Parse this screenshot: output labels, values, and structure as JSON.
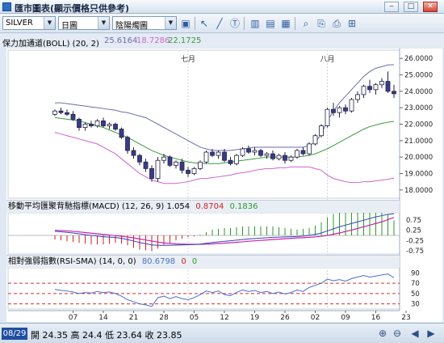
{
  "window": {
    "title": "匯市圖表(顯示價格只供參考)",
    "buttons": [
      "‒",
      "□",
      "✕"
    ]
  },
  "toolbar": {
    "symbol": "SILVER",
    "period": "日圖",
    "chart_style": "陰陽燭圖",
    "icons": [
      "save-icon",
      "cursor-icon",
      "line-tool-icon",
      "text-tool-icon",
      "bar-chart-icon",
      "indicator-icon",
      "compare-icon",
      "search-icon",
      "export-icon",
      "layout-icon"
    ]
  },
  "boll": {
    "label": "保力加通道(BOLL) (20, 2)",
    "v1": "25.6164",
    "v2": "18.7286",
    "v3": "22.1725",
    "c1": "#6b6bb0",
    "c2": "#cc66cc",
    "c3": "#3a9a3a"
  },
  "macd": {
    "label": "移動平均匯聚背馳指標(MACD) (12, 26, 9)",
    "v1": "1.054",
    "v2": "0.8704",
    "v3": "0.1836",
    "c2": "#cc2222",
    "c3": "#2a9a2a"
  },
  "rsi": {
    "label": "相對強弱指數(RSI-SMA) (14, 0, 0)",
    "v1": "80.6798",
    "v2": "0",
    "v3": "0",
    "c1": "#4a6fcc",
    "c2": "#cc2222",
    "c3": "#2a9a2a"
  },
  "chart_data": {
    "type": "candlestick",
    "month_labels": [
      {
        "label": "七月",
        "index": 22
      },
      {
        "label": "八月",
        "index": 45
      }
    ],
    "x_tick_labels": [
      {
        "label": "07",
        "index": 3
      },
      {
        "label": "14",
        "index": 8
      },
      {
        "label": "21",
        "index": 13
      },
      {
        "label": "28",
        "index": 18
      },
      {
        "label": "05",
        "index": 23
      },
      {
        "label": "12",
        "index": 28
      },
      {
        "label": "19",
        "index": 33
      },
      {
        "label": "26",
        "index": 38
      },
      {
        "label": "02",
        "index": 43
      },
      {
        "label": "09",
        "index": 48
      },
      {
        "label": "16",
        "index": 53
      },
      {
        "label": "23",
        "index": 58
      }
    ],
    "price_axis": {
      "ylim": [
        17.5,
        26.5
      ],
      "ticks": [
        "26.0000",
        "25.0000",
        "24.0000",
        "23.0000",
        "22.0000",
        "21.0000",
        "20.0000",
        "19.0000",
        "18.0000"
      ]
    },
    "macd_axis": {
      "ylim": [
        -0.9,
        1.1
      ],
      "ticks": [
        "0.75",
        "0.25",
        "-0.25",
        "-0.75"
      ]
    },
    "rsi_axis": {
      "ylim": [
        20,
        100
      ],
      "ticks": [
        "90",
        "70",
        "50",
        "30"
      ],
      "bands": [
        70,
        50,
        30
      ]
    },
    "candles": [
      [
        22.6,
        22.9,
        22.5,
        22.8
      ],
      [
        22.8,
        23.0,
        22.6,
        22.7
      ],
      [
        22.7,
        22.9,
        22.5,
        22.6
      ],
      [
        22.6,
        22.8,
        22.2,
        22.3
      ],
      [
        22.3,
        22.4,
        21.6,
        21.8
      ],
      [
        21.8,
        22.1,
        21.6,
        22.0
      ],
      [
        22.0,
        22.2,
        21.8,
        21.9
      ],
      [
        21.9,
        22.3,
        21.8,
        22.2
      ],
      [
        22.2,
        22.4,
        21.8,
        21.9
      ],
      [
        21.9,
        22.1,
        21.7,
        22.0
      ],
      [
        22.0,
        22.1,
        21.6,
        21.7
      ],
      [
        21.7,
        21.8,
        21.1,
        21.2
      ],
      [
        21.2,
        21.3,
        20.2,
        20.4
      ],
      [
        20.4,
        20.6,
        19.9,
        20.1
      ],
      [
        20.1,
        20.2,
        19.5,
        19.7
      ],
      [
        19.7,
        19.9,
        19.1,
        19.3
      ],
      [
        19.3,
        19.5,
        18.5,
        18.7
      ],
      [
        18.7,
        20.0,
        18.5,
        19.8
      ],
      [
        19.8,
        20.2,
        19.6,
        20.0
      ],
      [
        20.0,
        20.1,
        19.4,
        19.5
      ],
      [
        19.5,
        19.8,
        19.3,
        19.7
      ],
      [
        19.7,
        19.9,
        19.0,
        19.2
      ],
      [
        19.2,
        19.4,
        18.8,
        19.0
      ],
      [
        19.0,
        19.4,
        18.9,
        19.3
      ],
      [
        19.3,
        19.8,
        19.2,
        19.7
      ],
      [
        19.7,
        20.4,
        19.6,
        20.3
      ],
      [
        20.3,
        20.5,
        20.0,
        20.1
      ],
      [
        20.1,
        20.4,
        19.9,
        20.3
      ],
      [
        20.3,
        20.5,
        19.7,
        19.8
      ],
      [
        19.8,
        20.0,
        19.5,
        19.6
      ],
      [
        19.6,
        20.2,
        19.5,
        20.1
      ],
      [
        20.1,
        20.6,
        20.0,
        20.5
      ],
      [
        20.5,
        20.7,
        20.2,
        20.3
      ],
      [
        20.3,
        20.6,
        20.1,
        20.4
      ],
      [
        20.4,
        20.5,
        20.0,
        20.1
      ],
      [
        20.1,
        20.3,
        19.9,
        20.2
      ],
      [
        20.2,
        20.4,
        19.8,
        19.9
      ],
      [
        19.9,
        20.2,
        19.8,
        20.1
      ],
      [
        20.1,
        20.3,
        19.6,
        19.8
      ],
      [
        19.8,
        20.1,
        19.7,
        20.0
      ],
      [
        20.0,
        20.5,
        19.9,
        20.4
      ],
      [
        20.4,
        20.6,
        20.1,
        20.2
      ],
      [
        20.2,
        20.9,
        20.1,
        20.8
      ],
      [
        20.8,
        21.4,
        20.7,
        21.3
      ],
      [
        21.3,
        22.0,
        21.2,
        21.9
      ],
      [
        21.9,
        23.0,
        21.8,
        22.9
      ],
      [
        22.9,
        23.3,
        22.5,
        22.7
      ],
      [
        22.7,
        23.1,
        22.4,
        23.0
      ],
      [
        23.0,
        23.2,
        22.6,
        22.8
      ],
      [
        22.8,
        23.6,
        22.7,
        23.5
      ],
      [
        23.5,
        24.0,
        23.3,
        23.8
      ],
      [
        23.8,
        24.4,
        23.6,
        24.3
      ],
      [
        24.3,
        24.7,
        23.9,
        24.1
      ],
      [
        24.1,
        24.5,
        23.8,
        24.4
      ],
      [
        24.4,
        24.8,
        24.2,
        24.6
      ],
      [
        24.6,
        25.2,
        23.9,
        24.0
      ],
      [
        24.0,
        24.4,
        23.6,
        23.85
      ]
    ],
    "boll_upper": [
      23.3,
      23.3,
      23.25,
      23.2,
      23.15,
      23.1,
      23.05,
      23.0,
      22.95,
      22.9,
      22.85,
      22.75,
      22.7,
      22.6,
      22.5,
      22.4,
      22.2,
      22.0,
      21.8,
      21.6,
      21.4,
      21.2,
      21.0,
      20.8,
      20.6,
      20.5,
      20.4,
      20.4,
      20.4,
      20.4,
      20.45,
      20.5,
      20.55,
      20.6,
      20.6,
      20.6,
      20.6,
      20.6,
      20.6,
      20.6,
      20.6,
      20.6,
      20.7,
      20.9,
      21.4,
      22.2,
      22.8,
      23.3,
      23.7,
      24.1,
      24.5,
      24.9,
      25.2,
      25.4,
      25.5,
      25.6,
      25.6164
    ],
    "boll_middle": [
      22.4,
      22.35,
      22.3,
      22.25,
      22.2,
      22.1,
      22.0,
      21.9,
      21.8,
      21.65,
      21.5,
      21.35,
      21.2,
      21.0,
      20.8,
      20.6,
      20.4,
      20.25,
      20.1,
      20.0,
      19.9,
      19.8,
      19.7,
      19.65,
      19.6,
      19.6,
      19.6,
      19.6,
      19.65,
      19.7,
      19.75,
      19.8,
      19.85,
      19.9,
      19.95,
      20.0,
      20.0,
      20.0,
      20.0,
      20.0,
      20.0,
      20.05,
      20.1,
      20.2,
      20.35,
      20.5,
      20.7,
      20.9,
      21.1,
      21.3,
      21.5,
      21.7,
      21.85,
      21.95,
      22.05,
      22.12,
      22.1725
    ],
    "boll_lower": [
      21.5,
      21.4,
      21.3,
      21.2,
      21.1,
      21.0,
      20.9,
      20.8,
      20.6,
      20.4,
      20.2,
      19.9,
      19.6,
      19.3,
      19.0,
      18.8,
      18.6,
      18.5,
      18.4,
      18.4,
      18.4,
      18.45,
      18.5,
      18.6,
      18.7,
      18.7,
      18.75,
      18.8,
      18.85,
      18.9,
      19.0,
      19.05,
      19.1,
      19.2,
      19.25,
      19.3,
      19.3,
      19.35,
      19.35,
      19.4,
      19.4,
      19.4,
      19.4,
      19.3,
      19.2,
      18.9,
      18.7,
      18.6,
      18.5,
      18.45,
      18.45,
      18.5,
      18.5,
      18.55,
      18.6,
      18.65,
      18.7286
    ],
    "macd_line": [
      0.2,
      0.18,
      0.15,
      0.12,
      0.08,
      0.04,
      0.0,
      -0.03,
      -0.06,
      -0.08,
      -0.1,
      -0.14,
      -0.2,
      -0.27,
      -0.34,
      -0.4,
      -0.46,
      -0.48,
      -0.48,
      -0.48,
      -0.47,
      -0.46,
      -0.45,
      -0.44,
      -0.42,
      -0.38,
      -0.34,
      -0.31,
      -0.28,
      -0.26,
      -0.23,
      -0.2,
      -0.17,
      -0.15,
      -0.13,
      -0.11,
      -0.09,
      -0.08,
      -0.07,
      -0.06,
      -0.05,
      -0.03,
      0.0,
      0.05,
      0.12,
      0.22,
      0.32,
      0.42,
      0.5,
      0.58,
      0.66,
      0.74,
      0.82,
      0.9,
      0.96,
      1.02,
      1.054
    ],
    "macd_signal": [
      0.25,
      0.24,
      0.22,
      0.2,
      0.17,
      0.14,
      0.11,
      0.08,
      0.05,
      0.02,
      -0.01,
      -0.04,
      -0.08,
      -0.12,
      -0.17,
      -0.22,
      -0.27,
      -0.32,
      -0.36,
      -0.39,
      -0.41,
      -0.42,
      -0.43,
      -0.43,
      -0.43,
      -0.42,
      -0.41,
      -0.39,
      -0.37,
      -0.35,
      -0.33,
      -0.31,
      -0.28,
      -0.26,
      -0.24,
      -0.22,
      -0.2,
      -0.18,
      -0.16,
      -0.14,
      -0.12,
      -0.11,
      -0.09,
      -0.07,
      -0.04,
      0.0,
      0.06,
      0.12,
      0.19,
      0.26,
      0.34,
      0.42,
      0.5,
      0.58,
      0.66,
      0.77,
      0.8704
    ],
    "rsi": [
      58,
      56,
      55,
      53,
      50,
      52,
      51,
      54,
      52,
      53,
      50,
      45,
      38,
      34,
      30,
      28,
      25,
      42,
      45,
      40,
      44,
      40,
      38,
      42,
      48,
      55,
      52,
      55,
      48,
      46,
      52,
      57,
      54,
      56,
      52,
      54,
      50,
      53,
      49,
      52,
      57,
      54,
      62,
      66,
      70,
      78,
      75,
      77,
      74,
      79,
      82,
      85,
      82,
      84,
      86,
      88,
      80.6798
    ]
  },
  "status": {
    "date": "08/29",
    "text": "開 24.35 高 24.4 低 23.64 收 23.85",
    "icons": [
      "zoom-in-icon",
      "zoom-out-icon",
      "scroll-left-icon",
      "scroll-right-icon"
    ]
  }
}
